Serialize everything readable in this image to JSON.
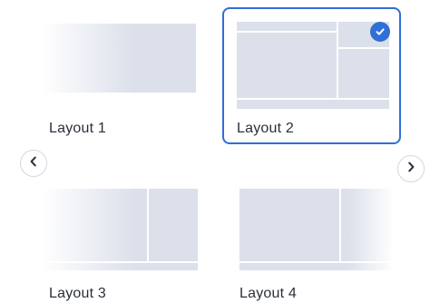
{
  "layouts": [
    {
      "label": "Layout 1",
      "selected": false
    },
    {
      "label": "Layout 2",
      "selected": true
    },
    {
      "label": "Layout 3",
      "selected": false
    },
    {
      "label": "Layout 4",
      "selected": false
    }
  ],
  "nav": {
    "prev_icon": "chevron-left-icon",
    "next_icon": "chevron-right-icon"
  },
  "icons": {
    "selected": "checkmark-icon"
  },
  "colors": {
    "accent": "#2f6fd6",
    "pane": "#dbe0ea",
    "text": "#2a2f3a"
  }
}
